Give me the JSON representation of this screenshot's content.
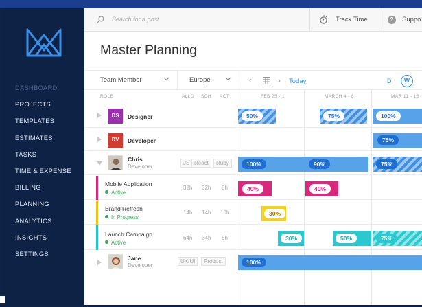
{
  "sidebar": {
    "items": [
      {
        "label": "DASHBOARD",
        "dim": true
      },
      {
        "label": "PROJECTS"
      },
      {
        "label": "TEMPLATES"
      },
      {
        "label": "ESTIMATES"
      },
      {
        "label": "TASKS"
      },
      {
        "label": "TIME & EXPENSE"
      },
      {
        "label": "BILLING"
      },
      {
        "label": "PLANNING"
      },
      {
        "label": "ANALYTICS"
      },
      {
        "label": "INSIGHTS"
      },
      {
        "label": "SETTINGS"
      }
    ]
  },
  "topbar": {
    "search_placeholder": "Search for a post",
    "track_time": "Track Time",
    "support": "Suppo"
  },
  "page": {
    "title": "Master Planning"
  },
  "filters": {
    "member": "Team Member",
    "region": "Europe",
    "today": "Today",
    "view_d": "D",
    "view_w": "W"
  },
  "headers": {
    "role": "ROLE",
    "allo": "ALLO",
    "sch": "SCH",
    "act": "ACT",
    "week1": "FEB 25 - 1",
    "week2": "MARCH 4 - 8",
    "week3": "MAR 11 - 15"
  },
  "roles": [
    {
      "badge": "DS",
      "name": "Designer",
      "color": "#9b2fae"
    },
    {
      "badge": "DV",
      "name": "Developer",
      "color": "#d63b2f"
    }
  ],
  "people": [
    {
      "name": "Chris",
      "role": "Developer",
      "tags": [
        "JS",
        "React",
        "Ruby"
      ]
    },
    {
      "name": "Jane",
      "role": "Developer",
      "tags": [
        "UX/UI",
        "Product"
      ]
    }
  ],
  "projects": [
    {
      "name": "Mobile Application",
      "status": "Active",
      "status_color": "#3aa95a",
      "color": "#d8297e",
      "allo": "32h",
      "sch": "32h",
      "act": "8h"
    },
    {
      "name": "Brand Refresh",
      "status": "In Progress",
      "status_color": "#3aa95a",
      "color": "#e8c418",
      "allo": "14h",
      "sch": "14h",
      "act": "10h"
    },
    {
      "name": "Launch Campaign",
      "status": "Active",
      "status_color": "#3aa95a",
      "color": "#27c3cb",
      "allo": "64h",
      "sch": "34h",
      "act": "8h"
    }
  ],
  "bars": {
    "designer_1": "50%",
    "designer_2": "75%",
    "designer_3": "100%",
    "developer_3": "75%",
    "chris_1": "100%",
    "chris_2": "90%",
    "chris_3": "75%",
    "mobile_1": "40%",
    "mobile_2": "40%",
    "brand_1": "30%",
    "launch_1": "30%",
    "launch_2": "50%",
    "launch_3": "75%",
    "jane_1": "100%"
  },
  "colors": {
    "accent": "#2e8ee6",
    "bar_blue": "#58a2ea",
    "pill_blue": "#1f6fd1",
    "magenta": "#d8297e",
    "yellow": "#f2d21e",
    "teal": "#2cc8cf"
  }
}
